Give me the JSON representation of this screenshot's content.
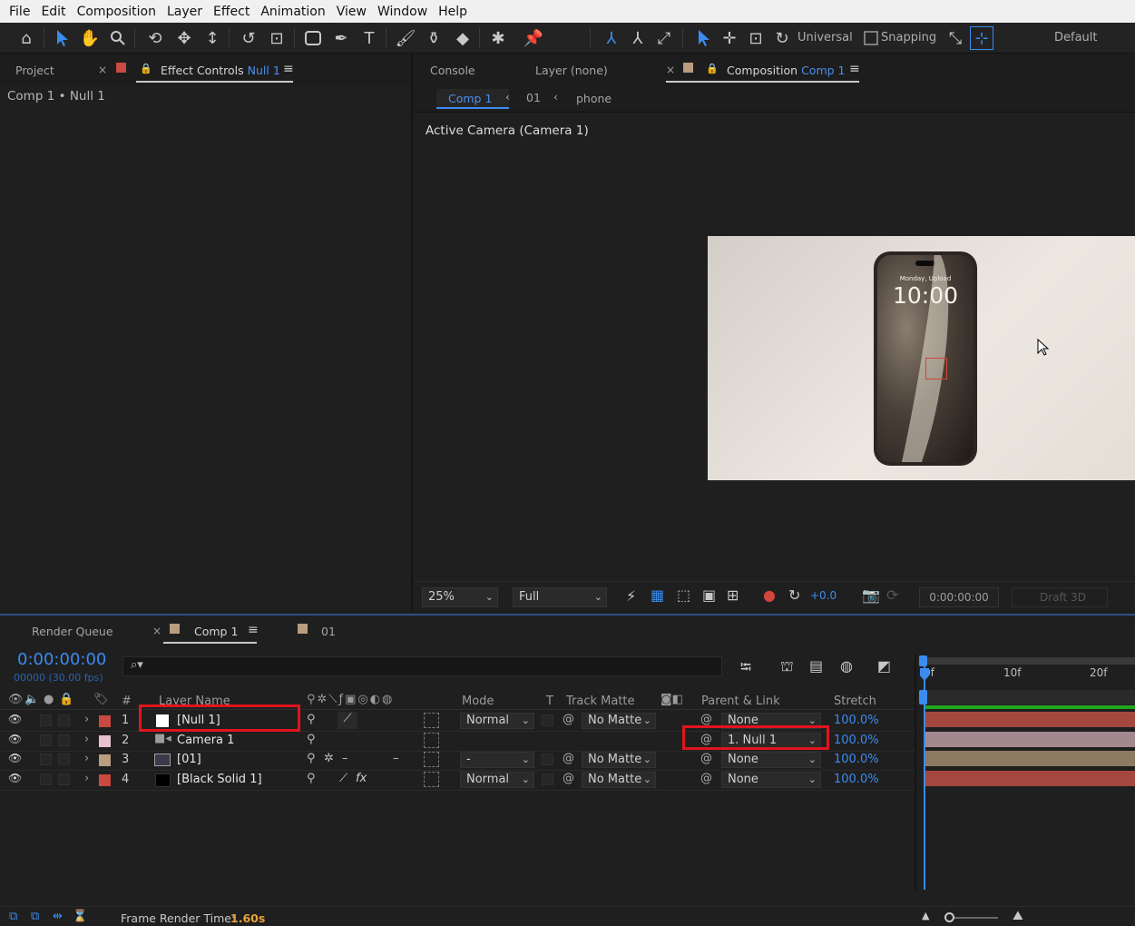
{
  "menu": [
    "File",
    "Edit",
    "Composition",
    "Layer",
    "Effect",
    "Animation",
    "View",
    "Window",
    "Help"
  ],
  "toolbar": {
    "icons": [
      "home-icon",
      "selection-tool-icon",
      "hand-tool-icon",
      "zoom-tool-icon",
      "orbit-tool-icon",
      "pan-tool-icon",
      "dolly-tool-icon",
      "rotate-tool-icon",
      "pan-behind-tool-icon",
      "rectangle-tool-icon",
      "pen-tool-icon",
      "type-tool-icon",
      "brush-tool-icon",
      "clone-stamp-icon",
      "eraser-icon",
      "roto-brush-icon",
      "puppet-pin-icon"
    ],
    "universal_label": "Universal",
    "snapping_label": "Snapping",
    "workspace": "Default"
  },
  "left_panel": {
    "tab_project": "Project",
    "tab_effect_controls": "Effect Controls",
    "effect_controls_target": "Null 1",
    "breadcrumb": "Comp 1 • Null 1"
  },
  "comp_panel": {
    "tab_console": "Console",
    "tab_layer": "Layer (none)",
    "tab_composition": "Composition",
    "composition_target": "Comp 1",
    "flow": [
      "Comp 1",
      "01",
      "phone"
    ],
    "active_camera": "Active Camera (Camera 1)",
    "phone": {
      "date": "Monday, Upload",
      "time": "10:00"
    },
    "footer": {
      "zoom": "25%",
      "resolution": "Full",
      "exposure": "+0.0",
      "timecode": "0:00:00:00",
      "draft3d": "Draft 3D"
    }
  },
  "timeline": {
    "tab_render_queue": "Render Queue",
    "tab_comp": "Comp 1",
    "tab_01": "01",
    "timecode": "0:00:00:00",
    "frames": "00000 (30.00 fps)",
    "columns": {
      "num": "#",
      "layer_name": "Layer Name",
      "mode": "Mode",
      "t": "T",
      "track_matte": "Track Matte",
      "parent_link": "Parent & Link",
      "stretch": "Stretch"
    },
    "ruler": [
      "0f",
      "10f",
      "20f"
    ],
    "layers": [
      {
        "num": "1",
        "name": "[Null 1]",
        "label_color": "#c94a40",
        "mode": "Normal",
        "matte": "No Matte",
        "parent": "None",
        "stretch": "100.0%",
        "bar_color": "#a4473f"
      },
      {
        "num": "2",
        "name": "Camera 1",
        "label_color": "#e6c3cc",
        "mode": "",
        "matte": "",
        "parent": "1. Null 1",
        "stretch": "100.0%",
        "bar_color": "#a48890"
      },
      {
        "num": "3",
        "name": "[01]",
        "label_color": "#b89d7e",
        "mode": "-",
        "matte": "No Matte",
        "parent": "None",
        "stretch": "100.0%",
        "bar_color": "#8d7a62"
      },
      {
        "num": "4",
        "name": "[Black Solid 1]",
        "label_color": "#c94a40",
        "mode": "Normal",
        "matte": "No Matte",
        "parent": "None",
        "stretch": "100.0%",
        "bar_color": "#a4473f"
      }
    ],
    "frame_render_label": "Frame Render Time:",
    "frame_render_value": "1.60s"
  },
  "colors": {
    "accent": "#3b8bf0",
    "highlight_box": "#e0141e",
    "render_time": "#e8a13a"
  }
}
